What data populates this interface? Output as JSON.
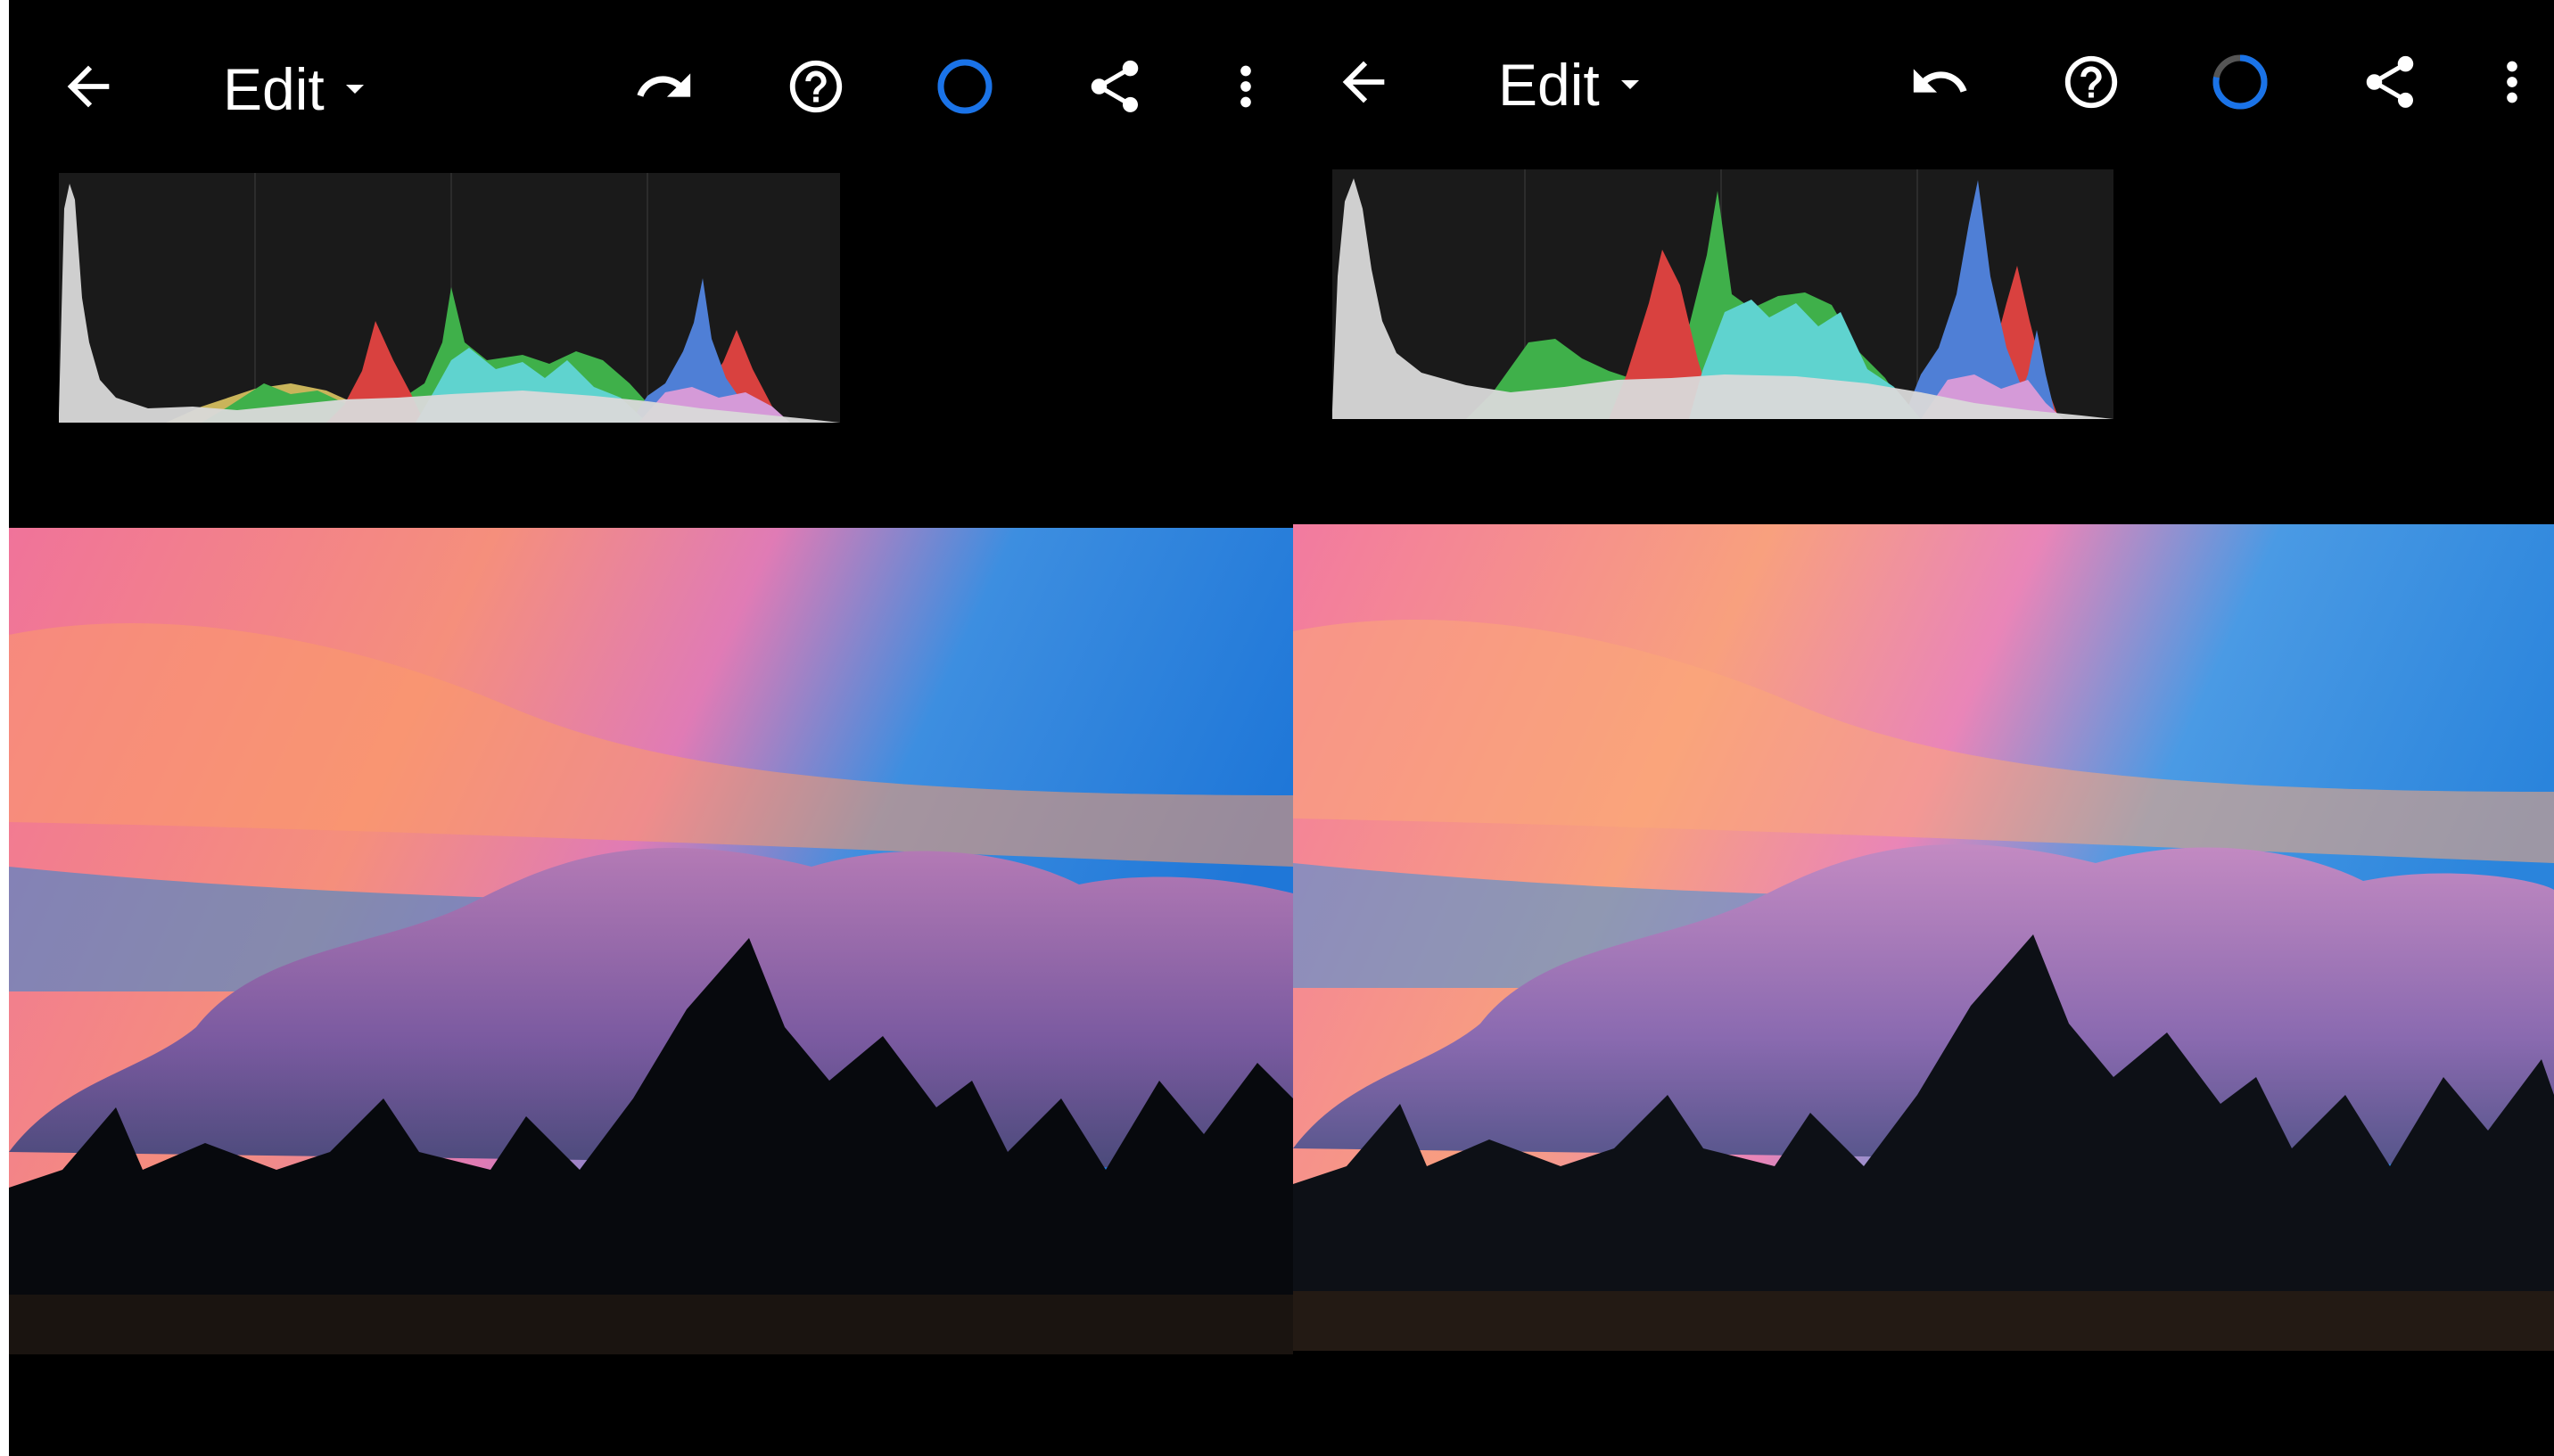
{
  "left_pane": {
    "menu_label": "Edit",
    "progress_ring": {
      "progress": 1.0,
      "color": "#1a73e8",
      "track": "#444444"
    }
  },
  "right_pane": {
    "menu_label": "Edit",
    "progress_ring": {
      "progress": 0.78,
      "color": "#1a73e8",
      "track": "#555555"
    }
  },
  "icons": {
    "back": "arrow-left-icon",
    "redo": "redo-icon",
    "undo": "undo-icon",
    "help": "help-icon",
    "share": "share-icon",
    "more": "more-vertical-icon",
    "dropdown": "caret-down-icon"
  },
  "colors": {
    "background": "#000000",
    "accent": "#1a73e8",
    "histogram_bg": "#1a1a1a",
    "hist_luminance": "#d9d9d9",
    "hist_red": "#d9413f",
    "hist_green": "#3fb04a",
    "hist_blue": "#4f7fd6",
    "hist_cyan": "#5fd3cf",
    "hist_yellow": "#c9b45a",
    "hist_magenta": "#d59ad8"
  }
}
